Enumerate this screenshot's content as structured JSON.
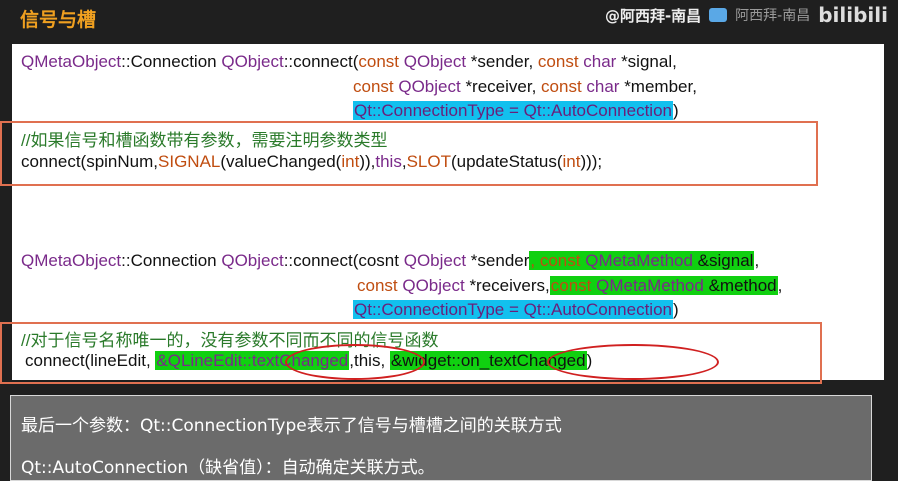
{
  "header": {
    "title": "信号与槽"
  },
  "watermark": {
    "handle": "@阿西拜-南昌",
    "ghost": "阿西拜-南昌",
    "logo": "bilibili"
  },
  "block1": {
    "l1": {
      "a": "QMetaObject",
      "b": "::Connection ",
      "c": "QObject",
      "d": "::connect(",
      "e": "const ",
      "f": "QObject",
      "g": " *sender, ",
      "h": "const ",
      "i": "char",
      "j": " *signal,"
    },
    "l2": {
      "a": "const ",
      "b": "QObject",
      "c": " *receiver, ",
      "d": "const ",
      "e": "char",
      "f": " *member,"
    },
    "l3": {
      "a": "Qt::ConnectionType = Qt::AutoConnection",
      "b": ")"
    },
    "comment": "//如果信号和槽函数带有参数，需要注明参数类型",
    "call": {
      "a": "connect(spinNum,",
      "b": "SIGNAL",
      "c": "(valueChanged(",
      "d": "int",
      "e": ")),",
      "f": "this",
      "g": ",",
      "h": "SLOT",
      "i": "(updateStatus(",
      "j": "int",
      "k": ")));"
    }
  },
  "block2": {
    "l1": {
      "a": "QMetaObject",
      "b": "::Connection ",
      "c": "QObject",
      "d": "::connect(cosnt ",
      "e": "QObject",
      "f": " *sender",
      "g": ", const ",
      "h": "QMetaMethod",
      "i": " &signal",
      "j": ","
    },
    "l2": {
      "a": "const ",
      "b": "QObject",
      "c": " *receivers,",
      "d": "const ",
      "e": "QMetaMethod",
      "f": " &method",
      "g": ","
    },
    "l3": {
      "a": "Qt::ConnectionType = Qt::AutoConnection",
      "b": ")"
    },
    "comment": "//对于信号名称唯一的，没有参数不同而不同的信号函数",
    "call": {
      "a": "connect(lineEdit, ",
      "b": "&QLineEdit::textChanged",
      "c": ",this, ",
      "d": "&widget::on_textChanged",
      "e": ")"
    }
  },
  "note": {
    "line1": "最后一个参数：Qt::ConnectionType表示了信号与槽槽之间的关联方式",
    "line2": "Qt::AutoConnection（缺省值）：自动确定关联方式。"
  }
}
